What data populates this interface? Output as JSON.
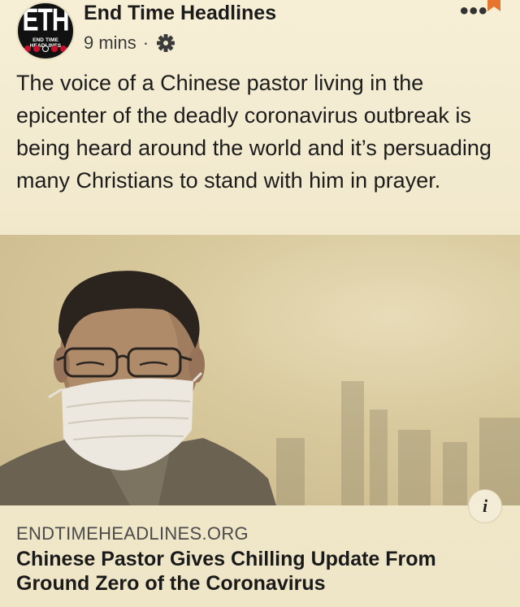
{
  "post": {
    "page_name": "End Time Headlines",
    "timestamp": "9 mins",
    "separator": "·",
    "privacy_icon": "gear-icon",
    "more_label": "•••",
    "text": "The voice of a Chinese pastor living in the epicenter of the deadly coronavirus outbreak is being heard around the world and it’s persuading many Christians to stand with him in prayer."
  },
  "avatar": {
    "logo_letters": "ETH",
    "logo_subtitle": "END TIME HEADLINES"
  },
  "link": {
    "domain": "ENDTIMEHEADLINES.ORG",
    "title": "Chinese Pastor Gives Chilling Update From Ground Zero of the Coronavirus",
    "info_label": "i"
  },
  "colors": {
    "background": "#f3ebd0",
    "logo_red": "#c8102e",
    "bookmark": "#e8752e"
  }
}
